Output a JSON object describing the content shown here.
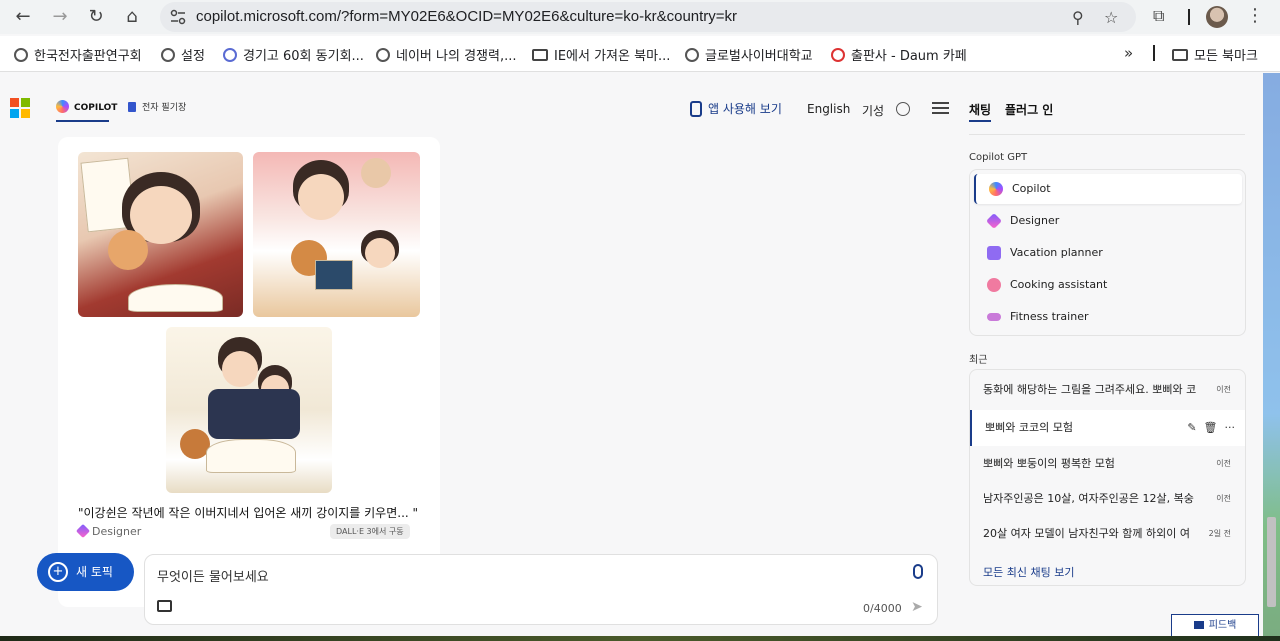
{
  "browser": {
    "url": "copilot.microsoft.com/?form=MY02E6&OCID=MY02E6&culture=ko-kr&country=kr",
    "icons": [
      "back-icon",
      "forward-icon",
      "reload-icon",
      "home-icon",
      "tune-icon",
      "zoom-icon",
      "star-icon",
      "extensions-icon",
      "menu-icon"
    ]
  },
  "bookmarks": {
    "items": [
      {
        "label": "한국전자출판연구회",
        "icon": "globe"
      },
      {
        "label": "설정",
        "icon": "globe"
      },
      {
        "label": "경기고 60회 동기회...",
        "icon": "navy"
      },
      {
        "label": "네이버 나의 경쟁력,...",
        "icon": "globe"
      },
      {
        "label": "IE에서 가져온 북마...",
        "icon": "folder"
      },
      {
        "label": "글로벌사이버대학교",
        "icon": "globe"
      },
      {
        "label": "출판사 - Daum 카페",
        "icon": "daum"
      }
    ],
    "overflow": "»",
    "all_bookmarks": "모든 북마크"
  },
  "header": {
    "tab_copilot": "COPILOT",
    "tab_notebook": "전자 필기장",
    "app_link": "앱 사용해 보기",
    "language": "English",
    "signin": "기성"
  },
  "chat": {
    "caption": "\"이강쉰은 작년에 작은 이버지네서 입어온 새끼 강이지를 키우면... \"",
    "designer_label": "Designer",
    "dalle_badge": "DALL·E 3에서 구동"
  },
  "composer": {
    "new_topic": "새 토픽",
    "placeholder": "무엇이든 물어보세요",
    "counter": "0/4000"
  },
  "sidebar": {
    "tabs": [
      "채팅",
      "플러그 인"
    ],
    "gpt_heading": "Copilot GPT",
    "gpts": [
      {
        "label": "Copilot",
        "color": "#6a7bff"
      },
      {
        "label": "Designer",
        "color": "#a35cff"
      },
      {
        "label": "Vacation planner",
        "color": "#8f6bf2"
      },
      {
        "label": "Cooking assistant",
        "color": "#f07aa0"
      },
      {
        "label": "Fitness trainer",
        "color": "#c97ad9"
      }
    ],
    "recent_heading": "최근",
    "recents": [
      {
        "title": "동화에 해당하는 그림을 그려주세요. 뽀삐와 코",
        "when": "이전"
      },
      {
        "title": "뽀삐와 코코의 모험",
        "when": ""
      },
      {
        "title": "뽀삐와 뽀둥이의 평복한 모험",
        "when": "이전"
      },
      {
        "title": "남자주인공은 10살, 여자주인공은 12살, 복숭",
        "when": "이전"
      },
      {
        "title": "20살 여자 모델이 남자친구와 함께 하외이 여",
        "when": "2일 전"
      }
    ],
    "see_all": "모든 최신 채팅 보기",
    "feedback": "피드백"
  },
  "colors": {
    "accent": "#1a3c8a",
    "new_topic_bg": "#1757c4"
  }
}
